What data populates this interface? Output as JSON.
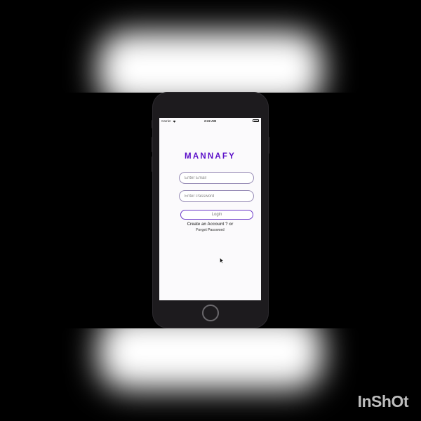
{
  "status_bar": {
    "carrier": "Carrier",
    "time": "2:22 AM"
  },
  "app": {
    "title": "MANNAFY"
  },
  "form": {
    "email_placeholder": "Enter Email",
    "password_placeholder": "Enter Password",
    "login_label": "Login",
    "create_account_text": "Create an Account ? or",
    "forget_password_text": "Forget Password"
  },
  "watermark": {
    "text": "InShOt"
  },
  "colors": {
    "brand_purple": "#5b0fc9",
    "login_border": "#6d3bc9",
    "background": "#000000",
    "phone_body": "#1d1b1e"
  },
  "icons": [
    "wifi-icon",
    "battery-icon",
    "mouse-pointer-icon",
    "home-button"
  ]
}
